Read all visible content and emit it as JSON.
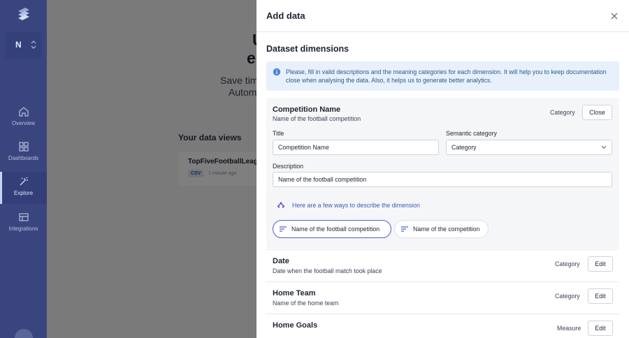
{
  "sidebar": {
    "workspace_letter": "N",
    "items": [
      {
        "label": "Overview",
        "icon": "home-icon",
        "active": false
      },
      {
        "label": "Dashboards",
        "icon": "grid-icon",
        "active": false
      },
      {
        "label": "Explore",
        "icon": "sparkle-icon",
        "active": true
      },
      {
        "label": "Integrations",
        "icon": "integrations-icon",
        "active": false
      }
    ]
  },
  "background": {
    "heading_line1": "U",
    "heading_line2": "e",
    "subtitle_line1": "Save time",
    "subtitle_line2": "Automa",
    "views_title": "Your data views",
    "card": {
      "title": "TopFiveFootballLeague",
      "badge": "CSV",
      "time": "1 minute ago"
    }
  },
  "modal": {
    "title": "Add data",
    "section_title": "Dataset dimensions",
    "info_text": "Please, fill in valid descriptions and the meaning categories for each dimension. It will help you to keep documentation close when analysing the data. Also, it helps us to generate better analytics.",
    "expanded": {
      "name": "Competition Name",
      "description": "Name of the football competition",
      "category_label": "Category",
      "close_label": "Close",
      "title_label": "Title",
      "title_value": "Competition Name",
      "semantic_label": "Semantic category",
      "semantic_value": "Category",
      "description_label": "Description",
      "description_value": "Name of the football competition",
      "hint": "Here are a few ways to describe the dimension",
      "suggestions": [
        "Name of the football competition",
        "Name of the competition"
      ]
    },
    "rows": [
      {
        "name": "Date",
        "description": "Date when the football match took place",
        "type": "Category",
        "action": "Edit"
      },
      {
        "name": "Home Team",
        "description": "Name of the home team",
        "type": "Category",
        "action": "Edit"
      },
      {
        "name": "Home Goals",
        "description": "",
        "type": "Measure",
        "action": "Edit"
      }
    ]
  },
  "colors": {
    "sidebar": "#3a4580",
    "info_bg": "#e7f0fb",
    "accent": "#4a63c8"
  }
}
